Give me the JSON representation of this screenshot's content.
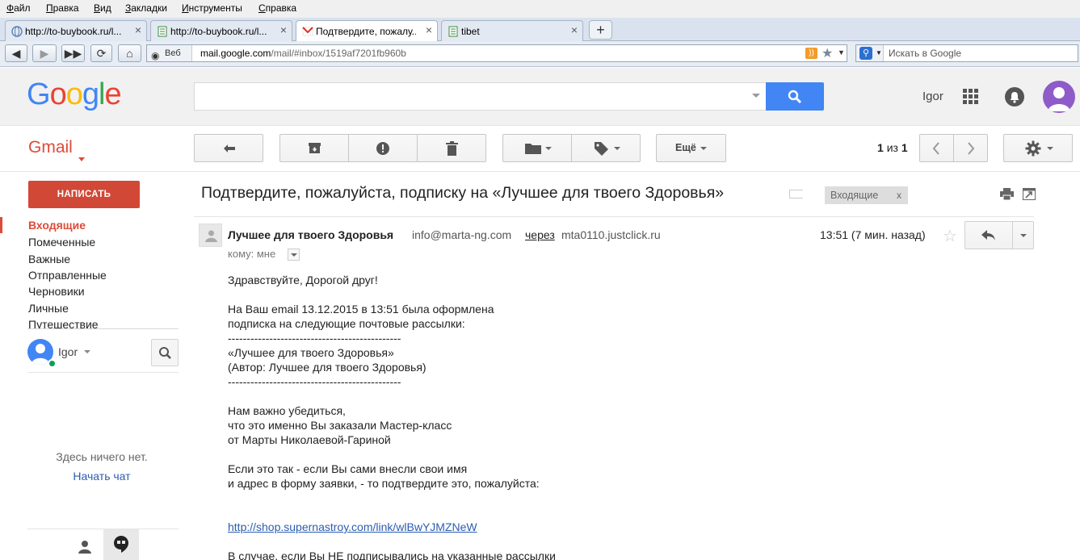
{
  "browser": {
    "menu": [
      "Файл",
      "Правка",
      "Вид",
      "Закладки",
      "Инструменты",
      "Справка"
    ],
    "tabs": [
      {
        "title": "http://to-buybook.ru/l...",
        "active": false,
        "icon": "globe-favicon"
      },
      {
        "title": "http://to-buybook.ru/l...",
        "active": false,
        "icon": "page-favicon"
      },
      {
        "title": "Подтвердите, пожалу...",
        "active": true,
        "icon": "gmail-favicon"
      },
      {
        "title": "tibet",
        "active": false,
        "icon": "page-favicon"
      }
    ],
    "identity_label": "Веб",
    "url_domain": "mail.google.com",
    "url_path": "/mail/#inbox/1519af7201fb960b",
    "search_placeholder": "Искать в Google"
  },
  "gmail": {
    "logo": "Google",
    "brand": "Gmail",
    "user_name": "Igor",
    "compose_label": "НАПИСАТЬ",
    "more_label": "Ещё",
    "pager": {
      "from": "1",
      "sep": "из",
      "total": "1"
    },
    "nav": [
      {
        "label": "Входящие",
        "active": true
      },
      {
        "label": "Помеченные",
        "active": false
      },
      {
        "label": "Важные",
        "active": false
      },
      {
        "label": "Отправленные",
        "active": false
      },
      {
        "label": "Черновики",
        "active": false
      },
      {
        "label": "Личные",
        "active": false
      },
      {
        "label": "Путешествие",
        "active": false
      }
    ],
    "chat": {
      "user": "Igor",
      "empty_text": "Здесь ничего нет.",
      "start_chat": "Начать чат"
    },
    "colors": {
      "accent": "#dd4b39",
      "search_button": "#4285f4",
      "link": "#2a5db0"
    }
  },
  "message": {
    "subject": "Подтвердите, пожалуйста, подписку на «Лучшее для твоего Здоровья»",
    "label": "Входящие",
    "label_remove": "x",
    "sender_name": "Лучшее для твоего Здоровья",
    "sender_email": "info@marta-ng.com",
    "via": "через",
    "via_domain": "mta0110.justclick.ru",
    "to_label": "кому: мне",
    "time": "13:51 (7 мин. назад)",
    "body": [
      "Здравствуйте, Дорогой друг!",
      "",
      "На Ваш email 13.12.2015 в 13:51 была оформлена",
      "подписка на следующие почтовые рассылки:",
      "----------------------------------------------",
      "«Лучшее для твоего Здоровья»",
      "(Автор: Лучшее для твоего Здоровья)",
      "----------------------------------------------",
      "",
      "Нам важно убедиться,",
      "что это именно Вы заказали Мастер-класс",
      "от Марты Николаевой-Гариной",
      "",
      "Если это так - если Вы сами внесли свои имя",
      "и адрес в форму заявки, - то подтвердите это, пожалуйста:",
      "",
      ""
    ],
    "link": "http://shop.supernastroy.com/link/wlBwYJMZNeW",
    "after_link": [
      "",
      "В случае, если Вы НЕ подписывались на указанные рассылки"
    ]
  }
}
